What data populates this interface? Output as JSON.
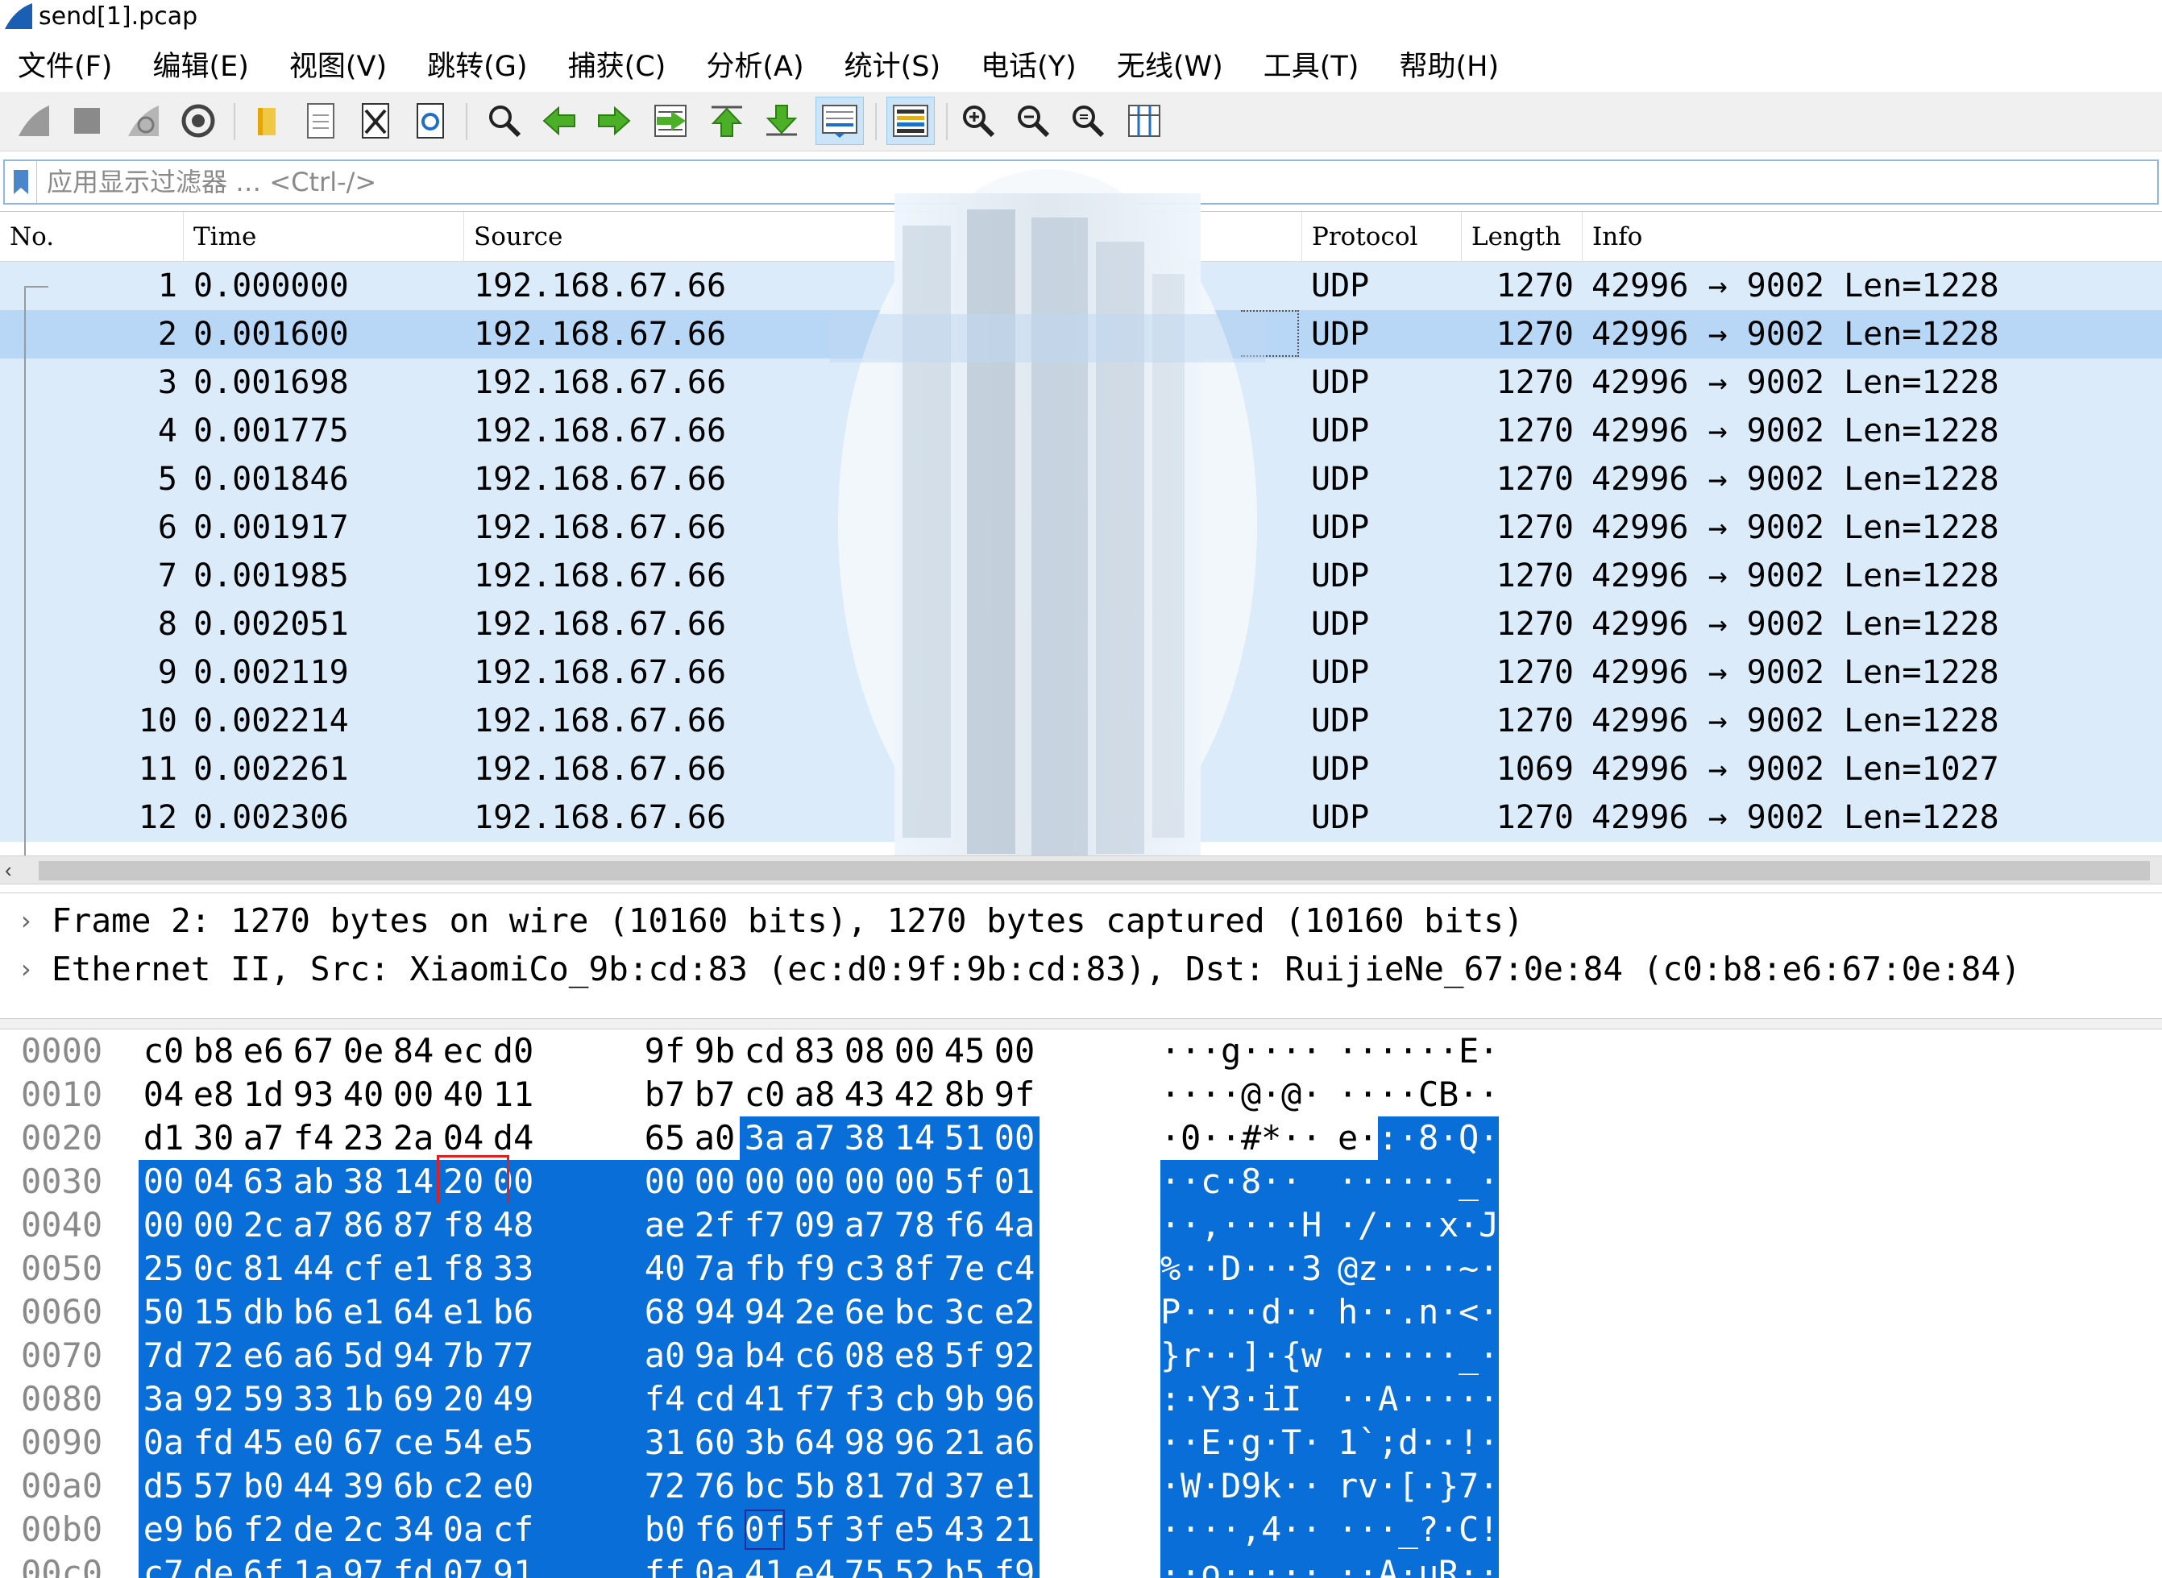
{
  "window": {
    "title": "send[1].pcap"
  },
  "menu": {
    "items": [
      "文件(F)",
      "编辑(E)",
      "视图(V)",
      "跳转(G)",
      "捕获(C)",
      "分析(A)",
      "统计(S)",
      "电话(Y)",
      "无线(W)",
      "工具(T)",
      "帮助(H)"
    ]
  },
  "toolbar": {
    "buttons": [
      "shark-fin-start-icon",
      "stop-icon",
      "restart-icon",
      "options-gear-icon",
      "open-folder-icon",
      "file-icon",
      "close-file-icon",
      "reload-icon",
      "find-icon",
      "back-arrow-icon",
      "forward-arrow-icon",
      "goto-packet-icon",
      "first-packet-icon",
      "last-packet-icon",
      "autoscroll-icon",
      "colorize-icon",
      "zoom-in-icon",
      "zoom-out-icon",
      "zoom-normal-icon",
      "resize-columns-icon"
    ]
  },
  "filter": {
    "placeholder": "应用显示过滤器 … <Ctrl-/>"
  },
  "packet_list": {
    "columns": [
      "No.",
      "Time",
      "Source",
      "Protocol",
      "Length",
      "Info"
    ],
    "rows": [
      {
        "no": "1",
        "time": "0.000000",
        "source": "192.168.67.66",
        "protocol": "UDP",
        "length": "1270",
        "info": "42996 → 9002 Len=1228"
      },
      {
        "no": "2",
        "time": "0.001600",
        "source": "192.168.67.66",
        "protocol": "UDP",
        "length": "1270",
        "info": "42996 → 9002 Len=1228"
      },
      {
        "no": "3",
        "time": "0.001698",
        "source": "192.168.67.66",
        "protocol": "UDP",
        "length": "1270",
        "info": "42996 → 9002 Len=1228"
      },
      {
        "no": "4",
        "time": "0.001775",
        "source": "192.168.67.66",
        "protocol": "UDP",
        "length": "1270",
        "info": "42996 → 9002 Len=1228"
      },
      {
        "no": "5",
        "time": "0.001846",
        "source": "192.168.67.66",
        "protocol": "UDP",
        "length": "1270",
        "info": "42996 → 9002 Len=1228"
      },
      {
        "no": "6",
        "time": "0.001917",
        "source": "192.168.67.66",
        "protocol": "UDP",
        "length": "1270",
        "info": "42996 → 9002 Len=1228"
      },
      {
        "no": "7",
        "time": "0.001985",
        "source": "192.168.67.66",
        "protocol": "UDP",
        "length": "1270",
        "info": "42996 → 9002 Len=1228"
      },
      {
        "no": "8",
        "time": "0.002051",
        "source": "192.168.67.66",
        "protocol": "UDP",
        "length": "1270",
        "info": "42996 → 9002 Len=1228"
      },
      {
        "no": "9",
        "time": "0.002119",
        "source": "192.168.67.66",
        "protocol": "UDP",
        "length": "1270",
        "info": "42996 → 9002 Len=1228"
      },
      {
        "no": "10",
        "time": "0.002214",
        "source": "192.168.67.66",
        "protocol": "UDP",
        "length": "1270",
        "info": "42996 → 9002 Len=1228"
      },
      {
        "no": "11",
        "time": "0.002261",
        "source": "192.168.67.66",
        "protocol": "UDP",
        "length": "1069",
        "info": "42996 → 9002 Len=1027"
      },
      {
        "no": "12",
        "time": "0.002306",
        "source": "192.168.67.66",
        "protocol": "UDP",
        "length": "1270",
        "info": "42996 → 9002 Len=1228"
      }
    ],
    "selected_row": 2
  },
  "details": {
    "lines": [
      "Frame 2: 1270 bytes on wire (10160 bits), 1270 bytes captured (10160 bits)",
      "Ethernet II, Src: XiaomiCo_9b:cd:83 (ec:d0:9f:9b:cd:83), Dst: RuijieNe_67:0e:84 (c0:b8:e6:67:0e:84)"
    ]
  },
  "bytes": {
    "rows": [
      {
        "offset": "0000",
        "hex": [
          "c0",
          "b8",
          "e6",
          "67",
          "0e",
          "84",
          "ec",
          "d0",
          "9f",
          "9b",
          "cd",
          "83",
          "08",
          "00",
          "45",
          "00"
        ],
        "ascii": "···g···· ······E·"
      },
      {
        "offset": "0010",
        "hex": [
          "04",
          "e8",
          "1d",
          "93",
          "40",
          "00",
          "40",
          "11",
          "b7",
          "b7",
          "c0",
          "a8",
          "43",
          "42",
          "8b",
          "9f"
        ],
        "ascii": "····@·@· ····CB··"
      },
      {
        "offset": "0020",
        "hex": [
          "d1",
          "30",
          "a7",
          "f4",
          "23",
          "2a",
          "04",
          "d4",
          "65",
          "a0",
          "3a",
          "a7",
          "38",
          "14",
          "51",
          "00"
        ],
        "ascii": "·0··#*·· e·:·8·Q·"
      },
      {
        "offset": "0030",
        "hex": [
          "00",
          "04",
          "63",
          "ab",
          "38",
          "14",
          "20",
          "00",
          "00",
          "00",
          "00",
          "00",
          "00",
          "00",
          "5f",
          "01"
        ],
        "ascii": "··c·8· · ······_·"
      },
      {
        "offset": "0040",
        "hex": [
          "00",
          "00",
          "2c",
          "a7",
          "86",
          "87",
          "f8",
          "48",
          "ae",
          "2f",
          "f7",
          "09",
          "a7",
          "78",
          "f6",
          "4a"
        ],
        "ascii": "··,····H ·/···x·J"
      },
      {
        "offset": "0050",
        "hex": [
          "25",
          "0c",
          "81",
          "44",
          "cf",
          "e1",
          "f8",
          "33",
          "40",
          "7a",
          "fb",
          "f9",
          "c3",
          "8f",
          "7e",
          "c4"
        ],
        "ascii": "%··D···3 @z····~·"
      },
      {
        "offset": "0060",
        "hex": [
          "50",
          "15",
          "db",
          "b6",
          "e1",
          "64",
          "e1",
          "b6",
          "68",
          "94",
          "94",
          "2e",
          "6e",
          "bc",
          "3c",
          "e2"
        ],
        "ascii": "P····d·· h··.n·<·"
      },
      {
        "offset": "0070",
        "hex": [
          "7d",
          "72",
          "e6",
          "a6",
          "5d",
          "94",
          "7b",
          "77",
          "a0",
          "9a",
          "b4",
          "c6",
          "08",
          "e8",
          "5f",
          "92"
        ],
        "ascii": "}r··]·{w ······_·"
      },
      {
        "offset": "0080",
        "hex": [
          "3a",
          "92",
          "59",
          "33",
          "1b",
          "69",
          "20",
          "49",
          "f4",
          "cd",
          "41",
          "f7",
          "f3",
          "cb",
          "9b",
          "96"
        ],
        "ascii": ":·Y3·i I ··A·····"
      },
      {
        "offset": "0090",
        "hex": [
          "0a",
          "fd",
          "45",
          "e0",
          "67",
          "ce",
          "54",
          "e5",
          "31",
          "60",
          "3b",
          "64",
          "98",
          "96",
          "21",
          "a6"
        ],
        "ascii": "··E·g·T· 1`;d··!·"
      },
      {
        "offset": "00a0",
        "hex": [
          "d5",
          "57",
          "b0",
          "44",
          "39",
          "6b",
          "c2",
          "e0",
          "72",
          "76",
          "bc",
          "5b",
          "81",
          "7d",
          "37",
          "e1"
        ],
        "ascii": "·W·D9k·· rv·[·}7·"
      },
      {
        "offset": "00b0",
        "hex": [
          "e9",
          "b6",
          "f2",
          "de",
          "2c",
          "34",
          "0a",
          "cf",
          "b0",
          "f6",
          "0f",
          "5f",
          "3f",
          "e5",
          "43",
          "21"
        ],
        "ascii": "····,4·· ···_?·C!"
      },
      {
        "offset": "00c0",
        "hex": [
          "c7",
          "de",
          "6f",
          "1a",
          "97",
          "fd",
          "07",
          "91",
          "ff",
          "0a",
          "41",
          "e4",
          "75",
          "52",
          "b5",
          "f9"
        ],
        "ascii": "··o····· ··A·uR··"
      }
    ],
    "highlight_start": 42,
    "red_box_index": 54,
    "focus_index": 186
  }
}
